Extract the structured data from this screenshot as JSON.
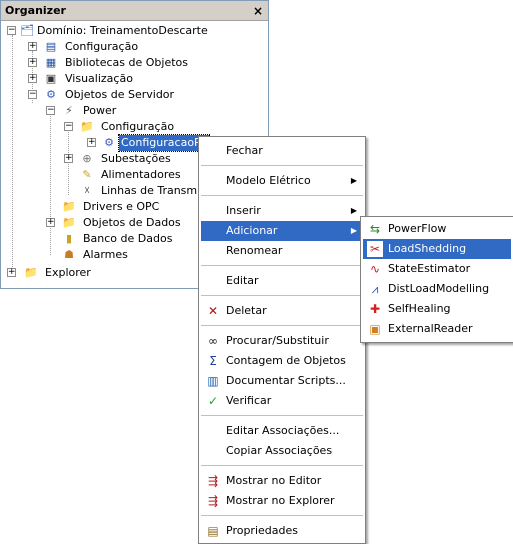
{
  "organizer": {
    "title": "Organizer",
    "close": "×",
    "tree": {
      "domain": "Domínio: TreinamentoDescarte",
      "configuracao": "Configuração",
      "bibliotecas": "Bibliotecas de Objetos",
      "visualizacao": "Visualização",
      "objetos_servidor": "Objetos de Servidor",
      "power": "Power",
      "power_configuracao": "Configuração",
      "configuracao_po": "ConfiguracaoPo",
      "subestacoes": "Subestações",
      "alimentadores": "Alimentadores",
      "linhas": "Linhas de Transmiss",
      "drivers": "Drivers e OPC",
      "objetos_dados": "Objetos de Dados",
      "banco_dados": "Banco de Dados",
      "alarmes": "Alarmes",
      "explorer": "Explorer"
    }
  },
  "context_menu": {
    "fechar": "Fechar",
    "modelo_eletrico": "Modelo Elétrico",
    "inserir": "Inserir",
    "adicionar": "Adicionar",
    "renomear": "Renomear",
    "editar": "Editar",
    "deletar": "Deletar",
    "procurar": "Procurar/Substituir",
    "contagem": "Contagem de Objetos",
    "documentar": "Documentar Scripts...",
    "verificar": "Verificar",
    "editar_assoc": "Editar Associações...",
    "copiar_assoc": "Copiar Associações",
    "mostrar_editor": "Mostrar no Editor",
    "mostrar_explorer": "Mostrar no Explorer",
    "propriedades": "Propriedades"
  },
  "submenu": {
    "powerflow": "PowerFlow",
    "loadshedding": "LoadShedding",
    "stateestimator": "StateEstimator",
    "distload": "DistLoadModelling",
    "selfhealing": "SelfHealing",
    "externalreader": "ExternalReader"
  },
  "icons": {
    "arrow": "▶",
    "plus": "+",
    "minus": "−"
  },
  "colors": {
    "highlight": "#316ac5",
    "panel_header": "#d4d0c8"
  }
}
